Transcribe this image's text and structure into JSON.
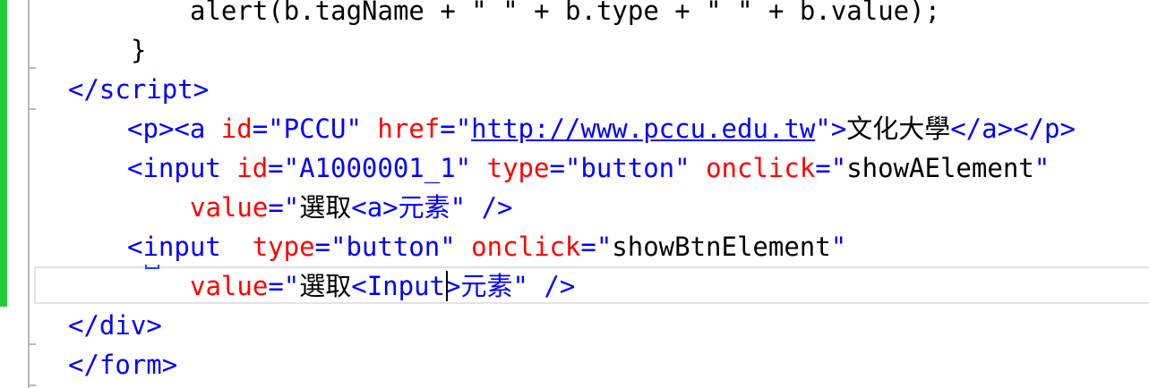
{
  "editor": {
    "lines": [
      {
        "tokens": [
          {
            "t": "alert(b.tagName + \" \" + b.type + \" \" + b.value);",
            "k": "code"
          }
        ]
      },
      {
        "tokens": [
          {
            "t": "}",
            "k": "code"
          }
        ]
      },
      {
        "tokens": [
          {
            "t": "</",
            "k": "tag"
          },
          {
            "t": "script",
            "k": "tag"
          },
          {
            "t": ">",
            "k": "tag"
          }
        ]
      },
      {
        "tokens": [
          {
            "t": "<",
            "k": "tag"
          },
          {
            "t": "p",
            "k": "tag"
          },
          {
            "t": "><",
            "k": "tag"
          },
          {
            "t": "a",
            "k": "tag"
          },
          {
            "t": " id",
            "k": "attr"
          },
          {
            "t": "=\"PCCU\"",
            "k": "val"
          },
          {
            "t": " href",
            "k": "attr"
          },
          {
            "t": "=\"",
            "k": "val"
          },
          {
            "t": "http://www.pccu.edu.tw",
            "k": "url"
          },
          {
            "t": "\">",
            "k": "val"
          },
          {
            "t": "文化大學",
            "k": "text"
          },
          {
            "t": "</",
            "k": "tag"
          },
          {
            "t": "a",
            "k": "tag"
          },
          {
            "t": "></",
            "k": "tag"
          },
          {
            "t": "p",
            "k": "tag"
          },
          {
            "t": ">",
            "k": "tag"
          }
        ]
      },
      {
        "tokens": [
          {
            "t": "<",
            "k": "tag"
          },
          {
            "t": "input",
            "k": "tag"
          },
          {
            "t": " id",
            "k": "attr"
          },
          {
            "t": "=\"A1000001_1\"",
            "k": "val"
          },
          {
            "t": " type",
            "k": "attr"
          },
          {
            "t": "=\"button\"",
            "k": "val"
          },
          {
            "t": " onclick",
            "k": "attr"
          },
          {
            "t": "=\"",
            "k": "val"
          },
          {
            "t": "showAElement",
            "k": "text"
          },
          {
            "t": "\"",
            "k": "val"
          }
        ]
      },
      {
        "tokens": [
          {
            "t": "value",
            "k": "attr"
          },
          {
            "t": "=\"",
            "k": "val"
          },
          {
            "t": "選取",
            "k": "text"
          },
          {
            "t": "<a>",
            "k": "val"
          },
          {
            "t": "元素",
            "k": "val"
          },
          {
            "t": "\"",
            "k": "val"
          },
          {
            "t": " />",
            "k": "tag"
          }
        ]
      },
      {
        "tokens": [
          {
            "t": "<",
            "k": "tag"
          },
          {
            "t": "input",
            "k": "tag"
          },
          {
            "t": "  type",
            "k": "attr"
          },
          {
            "t": "=\"button\"",
            "k": "val"
          },
          {
            "t": " onclick",
            "k": "attr"
          },
          {
            "t": "=\"",
            "k": "val"
          },
          {
            "t": "showBtnElement",
            "k": "text"
          },
          {
            "t": "\"",
            "k": "val"
          }
        ]
      },
      {
        "tokens": [
          {
            "t": "value",
            "k": "attr"
          },
          {
            "t": "=\"",
            "k": "val"
          },
          {
            "t": "選取",
            "k": "text"
          },
          {
            "t": "<Input>",
            "k": "val"
          },
          {
            "t": "元素",
            "k": "val"
          },
          {
            "t": "\"",
            "k": "val"
          },
          {
            "t": " />",
            "k": "tag"
          }
        ]
      },
      {
        "tokens": [
          {
            "t": "</",
            "k": "tag"
          },
          {
            "t": "div",
            "k": "tag"
          },
          {
            "t": ">",
            "k": "tag"
          }
        ]
      },
      {
        "tokens": [
          {
            "t": "</",
            "k": "tag"
          },
          {
            "t": "form",
            "k": "tag"
          },
          {
            "t": ">",
            "k": "tag"
          }
        ]
      }
    ]
  },
  "colors": {
    "tag": "#0000ff",
    "attr": "#ff0000",
    "value": "#0000ff",
    "text": "#000000",
    "change_bar": "#25c93a"
  }
}
